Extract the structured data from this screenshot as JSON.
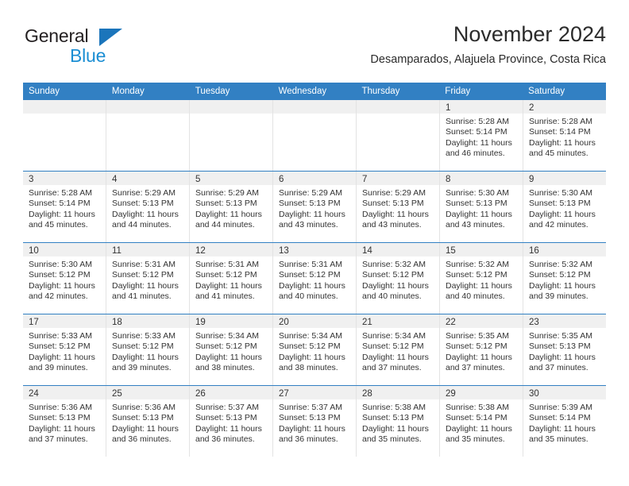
{
  "brand": {
    "name_part1": "General",
    "name_part2": "Blue",
    "triangle_icon": "triangle-icon",
    "accent_dark": "#231f20",
    "accent_blue": "#1b8ed3",
    "triangle_blue": "#1b75bb"
  },
  "header": {
    "title": "November 2024",
    "subtitle": "Desamparados, Alajuela Province, Costa Rica"
  },
  "calendar": {
    "header_bg": "#3280c3",
    "daynum_bg": "#f0f0f0",
    "weekdays": [
      "Sunday",
      "Monday",
      "Tuesday",
      "Wednesday",
      "Thursday",
      "Friday",
      "Saturday"
    ],
    "weeks": [
      [
        {
          "day": "",
          "empty": true
        },
        {
          "day": "",
          "empty": true
        },
        {
          "day": "",
          "empty": true
        },
        {
          "day": "",
          "empty": true
        },
        {
          "day": "",
          "empty": true
        },
        {
          "day": "1",
          "sunrise": "Sunrise: 5:28 AM",
          "sunset": "Sunset: 5:14 PM",
          "daylight": "Daylight: 11 hours and 46 minutes."
        },
        {
          "day": "2",
          "sunrise": "Sunrise: 5:28 AM",
          "sunset": "Sunset: 5:14 PM",
          "daylight": "Daylight: 11 hours and 45 minutes."
        }
      ],
      [
        {
          "day": "3",
          "sunrise": "Sunrise: 5:28 AM",
          "sunset": "Sunset: 5:14 PM",
          "daylight": "Daylight: 11 hours and 45 minutes."
        },
        {
          "day": "4",
          "sunrise": "Sunrise: 5:29 AM",
          "sunset": "Sunset: 5:13 PM",
          "daylight": "Daylight: 11 hours and 44 minutes."
        },
        {
          "day": "5",
          "sunrise": "Sunrise: 5:29 AM",
          "sunset": "Sunset: 5:13 PM",
          "daylight": "Daylight: 11 hours and 44 minutes."
        },
        {
          "day": "6",
          "sunrise": "Sunrise: 5:29 AM",
          "sunset": "Sunset: 5:13 PM",
          "daylight": "Daylight: 11 hours and 43 minutes."
        },
        {
          "day": "7",
          "sunrise": "Sunrise: 5:29 AM",
          "sunset": "Sunset: 5:13 PM",
          "daylight": "Daylight: 11 hours and 43 minutes."
        },
        {
          "day": "8",
          "sunrise": "Sunrise: 5:30 AM",
          "sunset": "Sunset: 5:13 PM",
          "daylight": "Daylight: 11 hours and 43 minutes."
        },
        {
          "day": "9",
          "sunrise": "Sunrise: 5:30 AM",
          "sunset": "Sunset: 5:13 PM",
          "daylight": "Daylight: 11 hours and 42 minutes."
        }
      ],
      [
        {
          "day": "10",
          "sunrise": "Sunrise: 5:30 AM",
          "sunset": "Sunset: 5:12 PM",
          "daylight": "Daylight: 11 hours and 42 minutes."
        },
        {
          "day": "11",
          "sunrise": "Sunrise: 5:31 AM",
          "sunset": "Sunset: 5:12 PM",
          "daylight": "Daylight: 11 hours and 41 minutes."
        },
        {
          "day": "12",
          "sunrise": "Sunrise: 5:31 AM",
          "sunset": "Sunset: 5:12 PM",
          "daylight": "Daylight: 11 hours and 41 minutes."
        },
        {
          "day": "13",
          "sunrise": "Sunrise: 5:31 AM",
          "sunset": "Sunset: 5:12 PM",
          "daylight": "Daylight: 11 hours and 40 minutes."
        },
        {
          "day": "14",
          "sunrise": "Sunrise: 5:32 AM",
          "sunset": "Sunset: 5:12 PM",
          "daylight": "Daylight: 11 hours and 40 minutes."
        },
        {
          "day": "15",
          "sunrise": "Sunrise: 5:32 AM",
          "sunset": "Sunset: 5:12 PM",
          "daylight": "Daylight: 11 hours and 40 minutes."
        },
        {
          "day": "16",
          "sunrise": "Sunrise: 5:32 AM",
          "sunset": "Sunset: 5:12 PM",
          "daylight": "Daylight: 11 hours and 39 minutes."
        }
      ],
      [
        {
          "day": "17",
          "sunrise": "Sunrise: 5:33 AM",
          "sunset": "Sunset: 5:12 PM",
          "daylight": "Daylight: 11 hours and 39 minutes."
        },
        {
          "day": "18",
          "sunrise": "Sunrise: 5:33 AM",
          "sunset": "Sunset: 5:12 PM",
          "daylight": "Daylight: 11 hours and 39 minutes."
        },
        {
          "day": "19",
          "sunrise": "Sunrise: 5:34 AM",
          "sunset": "Sunset: 5:12 PM",
          "daylight": "Daylight: 11 hours and 38 minutes."
        },
        {
          "day": "20",
          "sunrise": "Sunrise: 5:34 AM",
          "sunset": "Sunset: 5:12 PM",
          "daylight": "Daylight: 11 hours and 38 minutes."
        },
        {
          "day": "21",
          "sunrise": "Sunrise: 5:34 AM",
          "sunset": "Sunset: 5:12 PM",
          "daylight": "Daylight: 11 hours and 37 minutes."
        },
        {
          "day": "22",
          "sunrise": "Sunrise: 5:35 AM",
          "sunset": "Sunset: 5:12 PM",
          "daylight": "Daylight: 11 hours and 37 minutes."
        },
        {
          "day": "23",
          "sunrise": "Sunrise: 5:35 AM",
          "sunset": "Sunset: 5:13 PM",
          "daylight": "Daylight: 11 hours and 37 minutes."
        }
      ],
      [
        {
          "day": "24",
          "sunrise": "Sunrise: 5:36 AM",
          "sunset": "Sunset: 5:13 PM",
          "daylight": "Daylight: 11 hours and 37 minutes."
        },
        {
          "day": "25",
          "sunrise": "Sunrise: 5:36 AM",
          "sunset": "Sunset: 5:13 PM",
          "daylight": "Daylight: 11 hours and 36 minutes."
        },
        {
          "day": "26",
          "sunrise": "Sunrise: 5:37 AM",
          "sunset": "Sunset: 5:13 PM",
          "daylight": "Daylight: 11 hours and 36 minutes."
        },
        {
          "day": "27",
          "sunrise": "Sunrise: 5:37 AM",
          "sunset": "Sunset: 5:13 PM",
          "daylight": "Daylight: 11 hours and 36 minutes."
        },
        {
          "day": "28",
          "sunrise": "Sunrise: 5:38 AM",
          "sunset": "Sunset: 5:13 PM",
          "daylight": "Daylight: 11 hours and 35 minutes."
        },
        {
          "day": "29",
          "sunrise": "Sunrise: 5:38 AM",
          "sunset": "Sunset: 5:14 PM",
          "daylight": "Daylight: 11 hours and 35 minutes."
        },
        {
          "day": "30",
          "sunrise": "Sunrise: 5:39 AM",
          "sunset": "Sunset: 5:14 PM",
          "daylight": "Daylight: 11 hours and 35 minutes."
        }
      ]
    ]
  }
}
